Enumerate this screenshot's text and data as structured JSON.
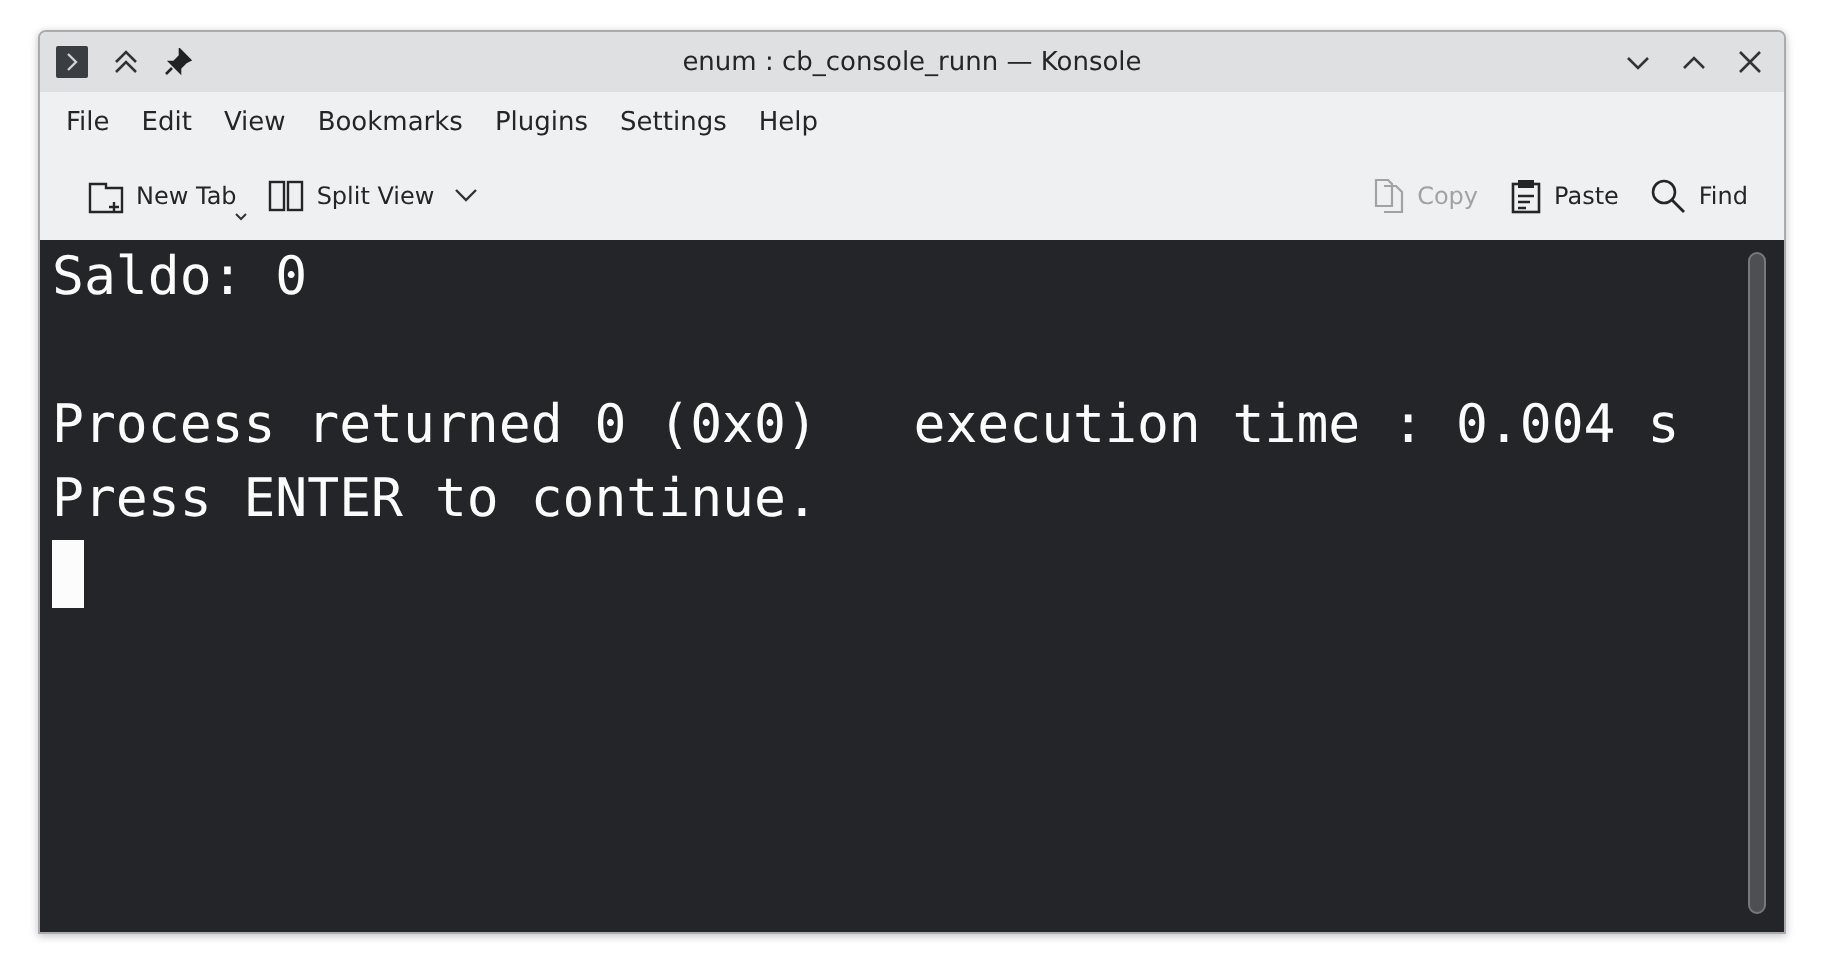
{
  "window": {
    "title": "enum : cb_console_runn — Konsole"
  },
  "menu": [
    "File",
    "Edit",
    "View",
    "Bookmarks",
    "Plugins",
    "Settings",
    "Help"
  ],
  "toolbar_left": [
    {
      "kind": "new-tab",
      "label": "New Tab",
      "disabled": false,
      "dropdown": true,
      "arrow_below": true
    },
    {
      "kind": "split-view",
      "label": "Split View",
      "disabled": false,
      "dropdown": true,
      "arrow_below": false
    }
  ],
  "toolbar_right": [
    {
      "kind": "copy",
      "label": "Copy",
      "disabled": true,
      "dropdown": false
    },
    {
      "kind": "paste",
      "label": "Paste",
      "disabled": false,
      "dropdown": false
    },
    {
      "kind": "find",
      "label": "Find",
      "disabled": false,
      "dropdown": false
    }
  ],
  "terminal": {
    "lines": [
      {
        "text": "Saldo: 0",
        "gap_before": false
      },
      {
        "text": "Process returned 0 (0x0)   execution time : 0.004 s",
        "gap_before": true
      },
      {
        "text": "Press ENTER to continue.",
        "gap_before": false
      }
    ],
    "cursor": true
  }
}
